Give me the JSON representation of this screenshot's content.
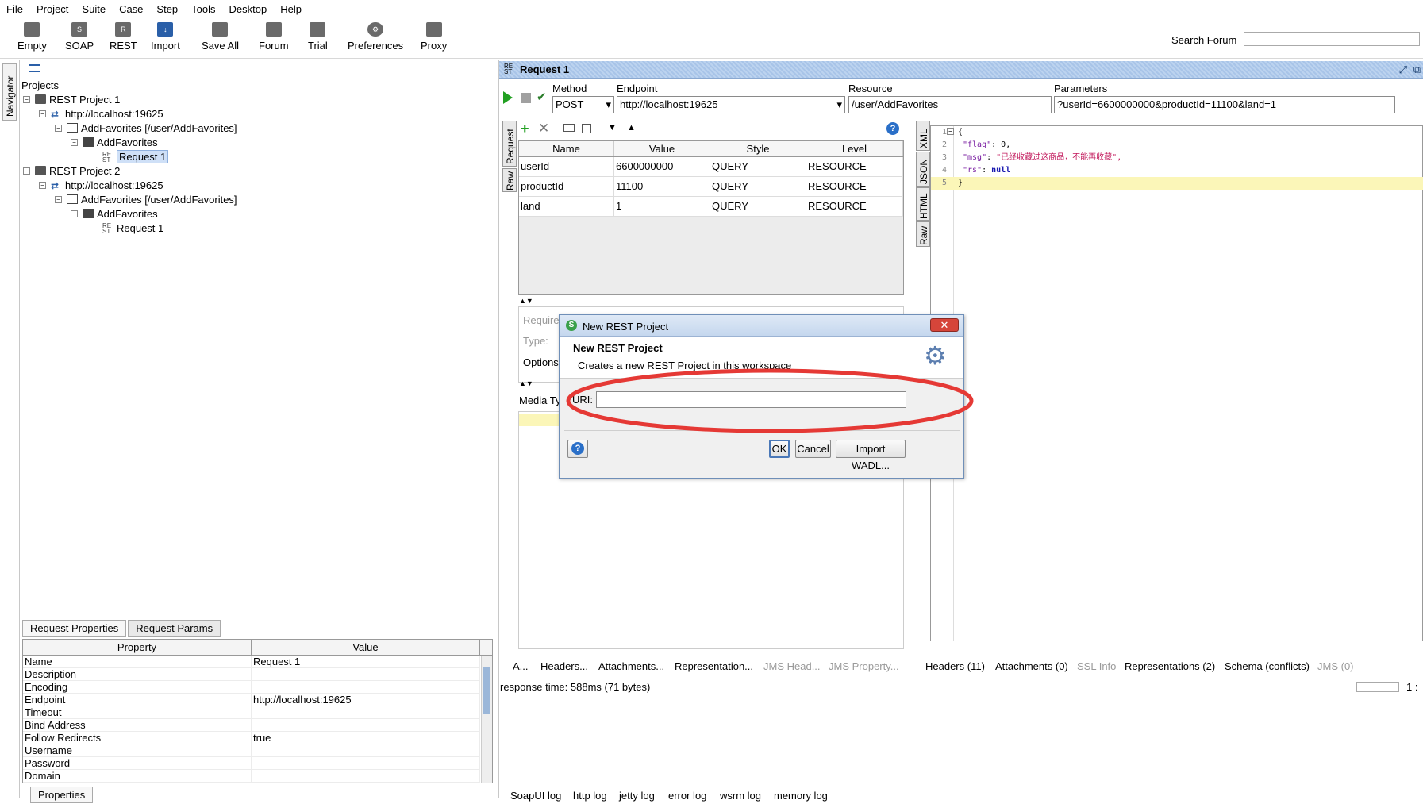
{
  "menu": [
    "File",
    "Project",
    "Suite",
    "Case",
    "Step",
    "Tools",
    "Desktop",
    "Help"
  ],
  "toolbar": {
    "buttons": [
      "Empty",
      "SOAP",
      "REST",
      "Import",
      "Save All",
      "Forum",
      "Trial",
      "Preferences",
      "Proxy"
    ],
    "search_label": "Search Forum"
  },
  "navigator": {
    "tab": "Navigator",
    "root": "Projects",
    "tree": [
      "REST Project 1",
      "http://localhost:19625",
      "AddFavorites [/user/AddFavorites]",
      "AddFavorites",
      "Request 1",
      "REST Project 2",
      "http://localhost:19625",
      "AddFavorites [/user/AddFavorites]",
      "AddFavorites",
      "Request 1"
    ]
  },
  "props": {
    "tabs": [
      "Request Properties",
      "Request Params"
    ],
    "headers": [
      "Property",
      "Value"
    ],
    "rows": [
      [
        "Name",
        "Request 1"
      ],
      [
        "Description",
        ""
      ],
      [
        "Encoding",
        ""
      ],
      [
        "Endpoint",
        "http://localhost:19625"
      ],
      [
        "Timeout",
        ""
      ],
      [
        "Bind Address",
        ""
      ],
      [
        "Follow Redirects",
        "true"
      ],
      [
        "Username",
        ""
      ],
      [
        "Password",
        ""
      ],
      [
        "Domain",
        ""
      ]
    ],
    "bottom_tab": "Properties"
  },
  "request": {
    "title": "Request 1",
    "method_label": "Method",
    "method_value": "POST",
    "endpoint_label": "Endpoint",
    "endpoint_value": "http://localhost:19625",
    "resource_label": "Resource",
    "resource_value": "/user/AddFavorites",
    "params_label": "Parameters",
    "params_value": "?userId=6600000000&productId=11100&land=1",
    "side_tabs": [
      "Request",
      "Raw"
    ],
    "grid_headers": [
      "Name",
      "Value",
      "Style",
      "Level"
    ],
    "grid_rows": [
      [
        "userId",
        "6600000000",
        "QUERY",
        "RESOURCE"
      ],
      [
        "productId",
        "11100",
        "QUERY",
        "RESOURCE"
      ],
      [
        "land",
        "1",
        "QUERY",
        "RESOURCE"
      ]
    ],
    "lower_labels": [
      "Require",
      "Type:",
      "Options"
    ],
    "media_label": "Media Ty",
    "bottom_tabs": [
      "A...",
      "Headers...",
      "Attachments...",
      "Representation...",
      "JMS Head...",
      "JMS Property..."
    ]
  },
  "response": {
    "side_tabs": [
      "XML",
      "JSON",
      "HTML",
      "Raw"
    ],
    "line_numbers": [
      "1",
      "2",
      "3",
      "4",
      "5"
    ],
    "lines": {
      "l1": "{",
      "flag_key": "\"flag\"",
      "flag_val": "0,",
      "msg_key": "\"msg\"",
      "msg_val": "\"已经收藏过这商品，不能再收藏\",",
      "rs_key": "\"rs\"",
      "rs_val": "null",
      "l5": "}"
    },
    "bottom_tabs": [
      "Headers (11)",
      "Attachments (0)",
      "SSL Info",
      "Representations (2)",
      "Schema (conflicts)",
      "JMS (0)"
    ],
    "status": "response time: 588ms (71 bytes)",
    "pos": "1 :"
  },
  "logs": [
    "SoapUI log",
    "http log",
    "jetty log",
    "error log",
    "wsrm log",
    "memory log"
  ],
  "dialog": {
    "title": "New REST Project",
    "heading": "New REST Project",
    "description": "Creates a new REST Project in this workspace",
    "uri_label": "URI:",
    "uri_value": "",
    "ok": "OK",
    "cancel": "Cancel",
    "import": "Import WADL..."
  },
  "colors": {
    "highlight_ellipse": "#e53935",
    "title_stripe": "#bcd3ef",
    "run_green": "#22a022"
  }
}
